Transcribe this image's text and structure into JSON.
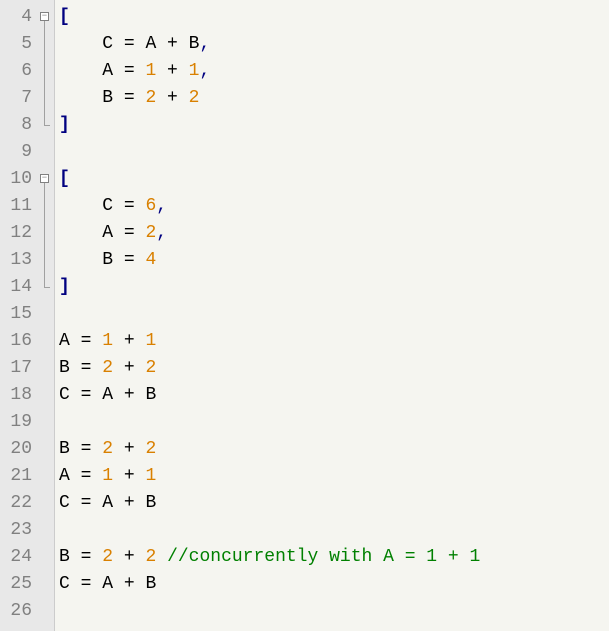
{
  "editor": {
    "first_line_number": 4,
    "line_count": 23,
    "fold_regions": [
      {
        "start": 4,
        "end": 8
      },
      {
        "start": 10,
        "end": 14
      }
    ],
    "lines": [
      {
        "n": 4,
        "tokens": [
          {
            "t": "[",
            "c": "bracket"
          }
        ]
      },
      {
        "n": 5,
        "indent": "    ",
        "tokens": [
          {
            "t": "C",
            "c": "var"
          },
          {
            "t": " = ",
            "c": "op"
          },
          {
            "t": "A",
            "c": "var"
          },
          {
            "t": " + ",
            "c": "op"
          },
          {
            "t": "B",
            "c": "var"
          },
          {
            "t": ",",
            "c": "punct"
          }
        ]
      },
      {
        "n": 6,
        "indent": "    ",
        "tokens": [
          {
            "t": "A",
            "c": "var"
          },
          {
            "t": " = ",
            "c": "op"
          },
          {
            "t": "1",
            "c": "num"
          },
          {
            "t": " + ",
            "c": "op"
          },
          {
            "t": "1",
            "c": "num"
          },
          {
            "t": ",",
            "c": "punct"
          }
        ]
      },
      {
        "n": 7,
        "indent": "    ",
        "tokens": [
          {
            "t": "B",
            "c": "var"
          },
          {
            "t": " = ",
            "c": "op"
          },
          {
            "t": "2",
            "c": "num"
          },
          {
            "t": " + ",
            "c": "op"
          },
          {
            "t": "2",
            "c": "num"
          }
        ]
      },
      {
        "n": 8,
        "tokens": [
          {
            "t": "]",
            "c": "bracket"
          }
        ]
      },
      {
        "n": 9,
        "tokens": []
      },
      {
        "n": 10,
        "tokens": [
          {
            "t": "[",
            "c": "bracket"
          }
        ]
      },
      {
        "n": 11,
        "indent": "    ",
        "tokens": [
          {
            "t": "C",
            "c": "var"
          },
          {
            "t": " = ",
            "c": "op"
          },
          {
            "t": "6",
            "c": "num"
          },
          {
            "t": ",",
            "c": "punct"
          }
        ]
      },
      {
        "n": 12,
        "indent": "    ",
        "tokens": [
          {
            "t": "A",
            "c": "var"
          },
          {
            "t": " = ",
            "c": "op"
          },
          {
            "t": "2",
            "c": "num"
          },
          {
            "t": ",",
            "c": "punct"
          }
        ]
      },
      {
        "n": 13,
        "indent": "    ",
        "tokens": [
          {
            "t": "B",
            "c": "var"
          },
          {
            "t": " = ",
            "c": "op"
          },
          {
            "t": "4",
            "c": "num"
          }
        ]
      },
      {
        "n": 14,
        "tokens": [
          {
            "t": "]",
            "c": "bracket"
          }
        ]
      },
      {
        "n": 15,
        "tokens": []
      },
      {
        "n": 16,
        "tokens": [
          {
            "t": "A",
            "c": "var"
          },
          {
            "t": " = ",
            "c": "op"
          },
          {
            "t": "1",
            "c": "num"
          },
          {
            "t": " + ",
            "c": "op"
          },
          {
            "t": "1",
            "c": "num"
          }
        ]
      },
      {
        "n": 17,
        "tokens": [
          {
            "t": "B",
            "c": "var"
          },
          {
            "t": " = ",
            "c": "op"
          },
          {
            "t": "2",
            "c": "num"
          },
          {
            "t": " + ",
            "c": "op"
          },
          {
            "t": "2",
            "c": "num"
          }
        ]
      },
      {
        "n": 18,
        "tokens": [
          {
            "t": "C",
            "c": "var"
          },
          {
            "t": " = ",
            "c": "op"
          },
          {
            "t": "A",
            "c": "var"
          },
          {
            "t": " + ",
            "c": "op"
          },
          {
            "t": "B",
            "c": "var"
          }
        ]
      },
      {
        "n": 19,
        "tokens": []
      },
      {
        "n": 20,
        "tokens": [
          {
            "t": "B",
            "c": "var"
          },
          {
            "t": " = ",
            "c": "op"
          },
          {
            "t": "2",
            "c": "num"
          },
          {
            "t": " + ",
            "c": "op"
          },
          {
            "t": "2",
            "c": "num"
          }
        ]
      },
      {
        "n": 21,
        "tokens": [
          {
            "t": "A",
            "c": "var"
          },
          {
            "t": " = ",
            "c": "op"
          },
          {
            "t": "1",
            "c": "num"
          },
          {
            "t": " + ",
            "c": "op"
          },
          {
            "t": "1",
            "c": "num"
          }
        ]
      },
      {
        "n": 22,
        "tokens": [
          {
            "t": "C",
            "c": "var"
          },
          {
            "t": " = ",
            "c": "op"
          },
          {
            "t": "A",
            "c": "var"
          },
          {
            "t": " + ",
            "c": "op"
          },
          {
            "t": "B",
            "c": "var"
          }
        ]
      },
      {
        "n": 23,
        "tokens": []
      },
      {
        "n": 24,
        "tokens": [
          {
            "t": "B",
            "c": "var"
          },
          {
            "t": " = ",
            "c": "op"
          },
          {
            "t": "2",
            "c": "num"
          },
          {
            "t": " + ",
            "c": "op"
          },
          {
            "t": "2",
            "c": "num"
          },
          {
            "t": " ",
            "c": "op"
          },
          {
            "t": "//concurrently with A = 1 + 1",
            "c": "comment"
          }
        ]
      },
      {
        "n": 25,
        "tokens": [
          {
            "t": "C",
            "c": "var"
          },
          {
            "t": " = ",
            "c": "op"
          },
          {
            "t": "A",
            "c": "var"
          },
          {
            "t": " + ",
            "c": "op"
          },
          {
            "t": "B",
            "c": "var"
          }
        ]
      },
      {
        "n": 26,
        "tokens": []
      }
    ]
  }
}
